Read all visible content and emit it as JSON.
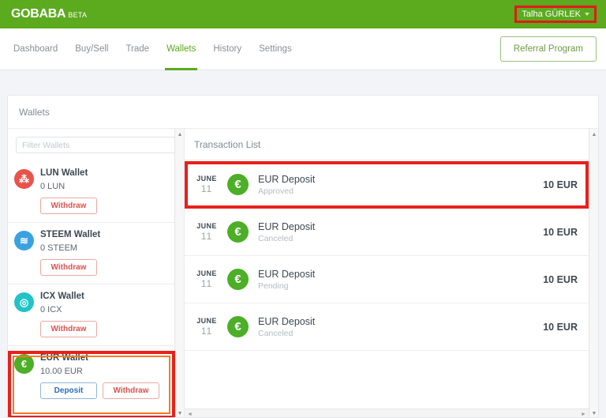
{
  "header": {
    "logo_main": "GOBABA",
    "logo_beta": "BETA",
    "user_name": "Talha GÜRLEK",
    "brand_green": "#5caa1e",
    "highlight_red": "#e8201b"
  },
  "nav": {
    "items": [
      {
        "label": "Dashboard",
        "active": false
      },
      {
        "label": "Buy/Sell",
        "active": false
      },
      {
        "label": "Trade",
        "active": false
      },
      {
        "label": "Wallets",
        "active": true
      },
      {
        "label": "History",
        "active": false
      },
      {
        "label": "Settings",
        "active": false
      }
    ],
    "referral_label": "Referral Program"
  },
  "card": {
    "title": "Wallets"
  },
  "wallets_panel": {
    "filter_placeholder": "Filter Wallets",
    "filter_value": "",
    "items": [
      {
        "name": "LUN Wallet",
        "balance": "0 LUN",
        "icon_color": "#e8534a",
        "icon_glyph": "⁂",
        "actions": [
          "Withdraw"
        ],
        "selected": false
      },
      {
        "name": "STEEM Wallet",
        "balance": "0 STEEM",
        "icon_color": "#3ba2e0",
        "icon_glyph": "≋",
        "actions": [
          "Withdraw"
        ],
        "selected": false
      },
      {
        "name": "ICX Wallet",
        "balance": "0 ICX",
        "icon_color": "#22c3c7",
        "icon_glyph": "◎",
        "actions": [
          "Withdraw"
        ],
        "selected": false
      },
      {
        "name": "EUR Wallet",
        "balance": "10.00 EUR",
        "icon_color": "#4caf27",
        "icon_glyph": "€",
        "actions": [
          "Deposit",
          "Withdraw"
        ],
        "selected": true
      }
    ]
  },
  "transactions_panel": {
    "title": "Transaction List",
    "rows": [
      {
        "month": "JUNE",
        "day": "11",
        "title": "EUR Deposit",
        "status": "Approved",
        "amount": "10 EUR",
        "icon_glyph": "€",
        "highlighted": true
      },
      {
        "month": "JUNE",
        "day": "11",
        "title": "EUR Deposit",
        "status": "Canceled",
        "amount": "10 EUR",
        "icon_glyph": "€",
        "highlighted": false
      },
      {
        "month": "JUNE",
        "day": "11",
        "title": "EUR Deposit",
        "status": "Pending",
        "amount": "10 EUR",
        "icon_glyph": "€",
        "highlighted": false
      },
      {
        "month": "JUNE",
        "day": "11",
        "title": "EUR Deposit",
        "status": "Canceled",
        "amount": "10 EUR",
        "icon_glyph": "€",
        "highlighted": false
      }
    ]
  },
  "scrollbars": {
    "arrow_up": "▲",
    "arrow_down": "▼",
    "arrow_left": "◄",
    "arrow_right": "►"
  }
}
